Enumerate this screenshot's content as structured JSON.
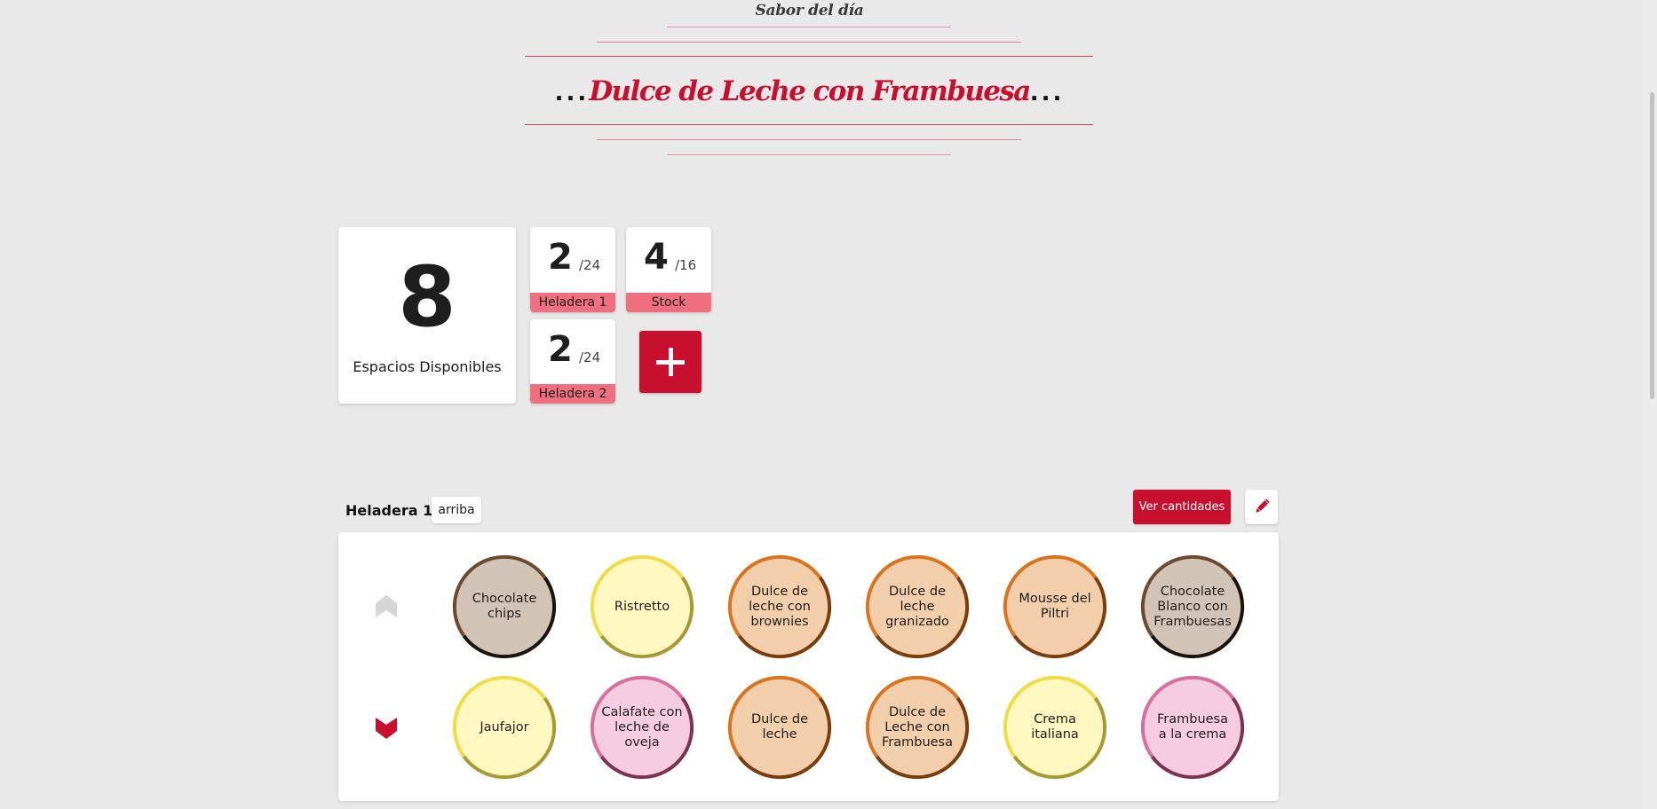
{
  "header": {
    "subtitle": "Sabor del día",
    "dots_left": "...",
    "flavor_name": "Dulce de Leche con Frambuesa",
    "dots_right": "...",
    "accent_color": "#c8102e"
  },
  "stats": {
    "available": {
      "value": "8",
      "label": "Espacios Disponibles"
    },
    "fridge1": {
      "value": "2",
      "denominator": "/24",
      "label": "Heladera 1"
    },
    "stock": {
      "value": "4",
      "denominator": "/16",
      "label": "Stock"
    },
    "fridge2": {
      "value": "2",
      "denominator": "/24",
      "label": "Heladera 2"
    },
    "add_icon": "plus-icon"
  },
  "section": {
    "title": "Heladera 1 -",
    "level": "arriba",
    "view_quantities_label": "Ver cantidades",
    "edit_icon": "pencil-icon"
  },
  "rows": [
    {
      "arrow_icon": "chevron-up-icon",
      "items": [
        {
          "name": "Chocolate chips",
          "fill": "#d1c3b6",
          "ring_light": "#6b4a30",
          "ring_dark": "#1a120c"
        },
        {
          "name": "Ristretto",
          "fill": "#fff8c0",
          "ring_light": "#f0dc45",
          "ring_dark": "#a89a32"
        },
        {
          "name": "Dulce de leche con brownies",
          "fill": "#f2ceaa",
          "ring_light": "#d97420",
          "ring_dark": "#7a3d0c"
        },
        {
          "name": "Dulce de leche granizado",
          "fill": "#f2ceaa",
          "ring_light": "#d97420",
          "ring_dark": "#7a3d0c"
        },
        {
          "name": "Mousse del Piltri",
          "fill": "#f2ceaa",
          "ring_light": "#d97420",
          "ring_dark": "#7a3d0c"
        },
        {
          "name": "Chocolate Blanco con Frambuesas",
          "fill": "#d1c3b6",
          "ring_light": "#6b4a30",
          "ring_dark": "#1a120c"
        }
      ]
    },
    {
      "arrow_icon": "chevron-down-icon",
      "items": [
        {
          "name": "Jaufajor",
          "fill": "#fff8c0",
          "ring_light": "#f0dc45",
          "ring_dark": "#a89a32"
        },
        {
          "name": "Calafate con leche de oveja",
          "fill": "#f6cde0",
          "ring_light": "#d86f9e",
          "ring_dark": "#7a3352"
        },
        {
          "name": "Dulce de leche",
          "fill": "#f2ceaa",
          "ring_light": "#d97420",
          "ring_dark": "#7a3d0c"
        },
        {
          "name": "Dulce de Leche con Frambuesa",
          "fill": "#f2ceaa",
          "ring_light": "#d97420",
          "ring_dark": "#7a3d0c"
        },
        {
          "name": "Crema italiana",
          "fill": "#fff8c0",
          "ring_light": "#f0dc45",
          "ring_dark": "#a89a32"
        },
        {
          "name": "Frambuesa a la crema",
          "fill": "#f6cde0",
          "ring_light": "#d86f9e",
          "ring_dark": "#7a3352"
        }
      ]
    }
  ]
}
